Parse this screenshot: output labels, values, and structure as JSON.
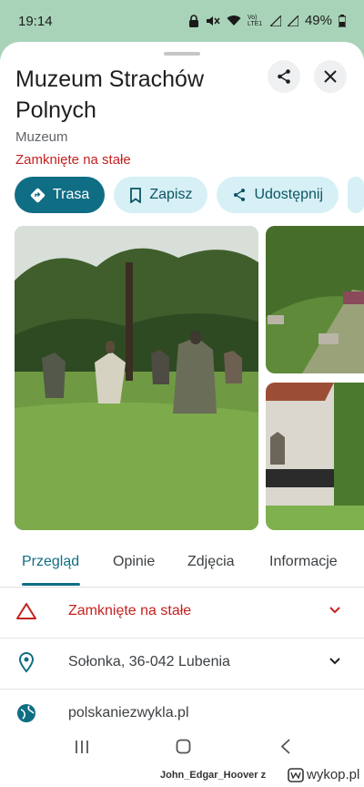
{
  "status_bar": {
    "time": "19:14",
    "battery": "49%",
    "network": "Vo) LTE1"
  },
  "place": {
    "name": "Muzeum Strachów Polnych",
    "category": "Muzeum",
    "status": "Zamknięte na stałe"
  },
  "actions": [
    {
      "label": "Trasa",
      "icon": "directions-icon"
    },
    {
      "label": "Zapisz",
      "icon": "bookmark-icon"
    },
    {
      "label": "Udostępnij",
      "icon": "share-icon"
    }
  ],
  "tabs": [
    "Przegląd",
    "Opinie",
    "Zdjęcia",
    "Informacje"
  ],
  "info_rows": [
    {
      "icon": "warning-icon",
      "text": "Zamknięte na stałe",
      "color": "#c5221f"
    },
    {
      "icon": "location-pin-icon",
      "text": "Sołonka, 36-042 Lubenia"
    },
    {
      "icon": "globe-icon",
      "text": "polskaniezwykla.pl"
    }
  ],
  "watermark": {
    "user": "John_Edgar_Hoover z",
    "site": "wykop.pl"
  },
  "colors": {
    "accent": "#0f6e84",
    "danger": "#c5221f",
    "chip_tonal": "#d6f0f6",
    "map_bg": "#a9d3b9"
  }
}
